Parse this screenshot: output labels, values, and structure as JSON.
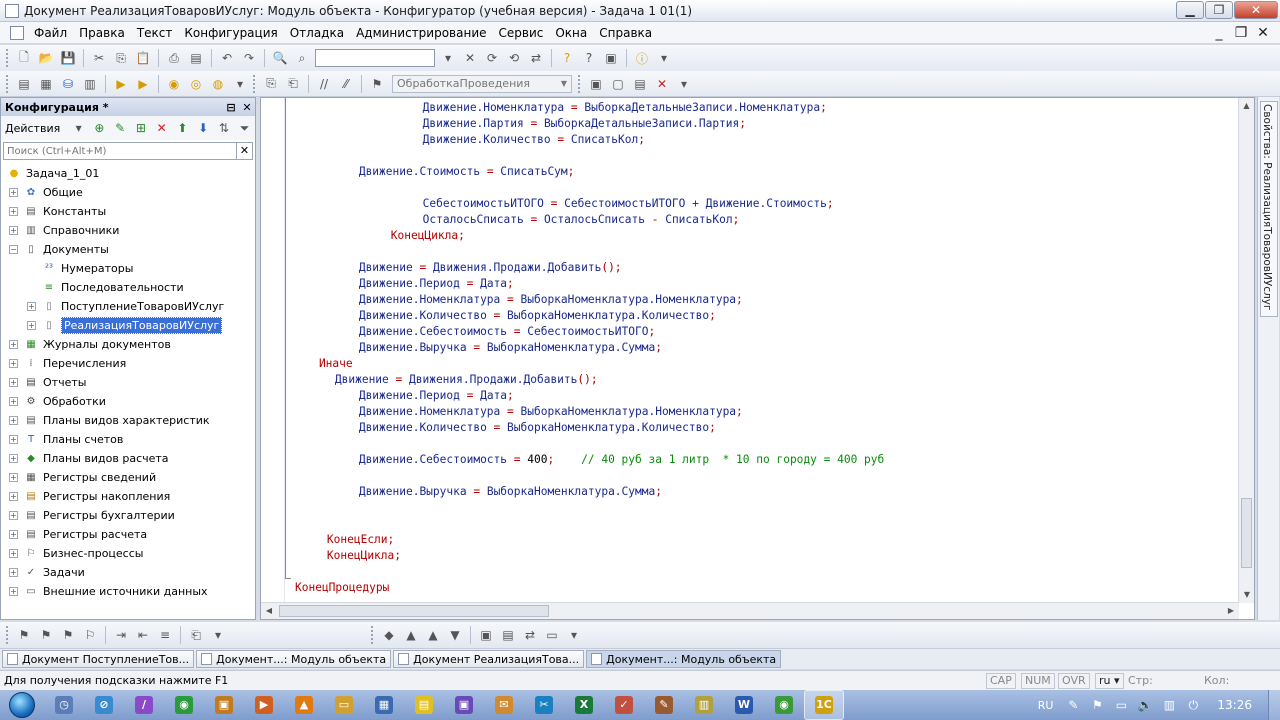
{
  "window": {
    "title": "Документ РеализацияТоваровИУслуг: Модуль объекта - Конфигуратор (учебная версия) - Задача 1 01(1)"
  },
  "menu": [
    "Файл",
    "Правка",
    "Текст",
    "Конфигурация",
    "Отладка",
    "Администрирование",
    "Сервис",
    "Окна",
    "Справка"
  ],
  "toolbar2": {
    "procedure_combo": "ОбработкаПроведения"
  },
  "config_panel": {
    "title": "Конфигурация *",
    "actions_label": "Действия",
    "search_placeholder": "Поиск (Ctrl+Alt+M)",
    "tree": [
      {
        "label": "Задача_1_01",
        "icon": "config-root-icon",
        "level": 0,
        "expander": ""
      },
      {
        "label": "Общие",
        "icon": "common-icon",
        "level": 1,
        "expander": "+"
      },
      {
        "label": "Константы",
        "icon": "constants-icon",
        "level": 1,
        "expander": "+"
      },
      {
        "label": "Справочники",
        "icon": "catalogs-icon",
        "level": 1,
        "expander": "+"
      },
      {
        "label": "Документы",
        "icon": "documents-icon",
        "level": 1,
        "expander": "−"
      },
      {
        "label": "Нумераторы",
        "icon": "numerators-icon",
        "level": 2,
        "expander": ""
      },
      {
        "label": "Последовательности",
        "icon": "sequences-icon",
        "level": 2,
        "expander": ""
      },
      {
        "label": "ПоступлениеТоваровИУслуг",
        "icon": "document-icon",
        "level": 2,
        "expander": "+"
      },
      {
        "label": "РеализацияТоваровИУслуг",
        "icon": "document-icon",
        "level": 2,
        "expander": "+",
        "selected": true
      },
      {
        "label": "Журналы документов",
        "icon": "journals-icon",
        "level": 1,
        "expander": "+"
      },
      {
        "label": "Перечисления",
        "icon": "enums-icon",
        "level": 1,
        "expander": "+"
      },
      {
        "label": "Отчеты",
        "icon": "reports-icon",
        "level": 1,
        "expander": "+"
      },
      {
        "label": "Обработки",
        "icon": "dataprocessors-icon",
        "level": 1,
        "expander": "+"
      },
      {
        "label": "Планы видов характеристик",
        "icon": "chart-of-characteristic-types-icon",
        "level": 1,
        "expander": "+"
      },
      {
        "label": "Планы счетов",
        "icon": "chart-of-accounts-icon",
        "level": 1,
        "expander": "+"
      },
      {
        "label": "Планы видов расчета",
        "icon": "chart-of-calculation-types-icon",
        "level": 1,
        "expander": "+"
      },
      {
        "label": "Регистры сведений",
        "icon": "information-registers-icon",
        "level": 1,
        "expander": "+"
      },
      {
        "label": "Регистры накопления",
        "icon": "accumulation-registers-icon",
        "level": 1,
        "expander": "+"
      },
      {
        "label": "Регистры бухгалтерии",
        "icon": "accounting-registers-icon",
        "level": 1,
        "expander": "+"
      },
      {
        "label": "Регистры расчета",
        "icon": "calculation-registers-icon",
        "level": 1,
        "expander": "+"
      },
      {
        "label": "Бизнес-процессы",
        "icon": "business-processes-icon",
        "level": 1,
        "expander": "+"
      },
      {
        "label": "Задачи",
        "icon": "tasks-icon",
        "level": 1,
        "expander": "+"
      },
      {
        "label": "Внешние источники данных",
        "icon": "external-data-sources-icon",
        "level": 1,
        "expander": "+"
      }
    ]
  },
  "code_lines": [
    {
      "indent": 16,
      "tokens": [
        [
          "id",
          "Движение.Номенклатура"
        ],
        [
          "op",
          " = "
        ],
        [
          "id",
          "ВыборкаДетальныеЗаписи.Номенклатура"
        ],
        [
          "op",
          ";"
        ]
      ]
    },
    {
      "indent": 16,
      "tokens": [
        [
          "id",
          "Движение.Партия"
        ],
        [
          "op",
          " = "
        ],
        [
          "id",
          "ВыборкаДетальныеЗаписи.Партия"
        ],
        [
          "op",
          ";"
        ]
      ]
    },
    {
      "indent": 16,
      "tokens": [
        [
          "id",
          "Движение.Количество"
        ],
        [
          "op",
          " = "
        ],
        [
          "id",
          "СписатьКол"
        ],
        [
          "op",
          ";"
        ]
      ]
    },
    {
      "indent": 0,
      "tokens": []
    },
    {
      "indent": 8,
      "tokens": [
        [
          "id",
          "Движение.Стоимость"
        ],
        [
          "op",
          " = "
        ],
        [
          "id",
          "СписатьСум"
        ],
        [
          "op",
          ";"
        ]
      ]
    },
    {
      "indent": 0,
      "tokens": []
    },
    {
      "indent": 16,
      "tokens": [
        [
          "id",
          "СебестоимостьИТОГО"
        ],
        [
          "op",
          " = "
        ],
        [
          "id",
          "СебестоимостьИТОГО"
        ],
        [
          "op",
          " + "
        ],
        [
          "id",
          "Движение.Стоимость"
        ],
        [
          "op",
          ";"
        ]
      ]
    },
    {
      "indent": 16,
      "tokens": [
        [
          "id",
          "ОсталосьСписать"
        ],
        [
          "op",
          " = "
        ],
        [
          "id",
          "ОсталосьСписать"
        ],
        [
          "op",
          " - "
        ],
        [
          "id",
          "СписатьКол"
        ],
        [
          "op",
          ";"
        ]
      ]
    },
    {
      "indent": 12,
      "tokens": [
        [
          "kw",
          "КонецЦикла"
        ],
        [
          "op",
          ";"
        ]
      ]
    },
    {
      "indent": 0,
      "tokens": []
    },
    {
      "indent": 8,
      "tokens": [
        [
          "id",
          "Движение"
        ],
        [
          "op",
          " = "
        ],
        [
          "id",
          "Движения.Продажи.Добавить"
        ],
        [
          "op",
          "();"
        ]
      ]
    },
    {
      "indent": 8,
      "tokens": [
        [
          "id",
          "Движение.Период"
        ],
        [
          "op",
          " = "
        ],
        [
          "id",
          "Дата"
        ],
        [
          "op",
          ";"
        ]
      ]
    },
    {
      "indent": 8,
      "tokens": [
        [
          "id",
          "Движение.Номенклатура"
        ],
        [
          "op",
          " = "
        ],
        [
          "id",
          "ВыборкаНоменклатура.Номенклатура"
        ],
        [
          "op",
          ";"
        ]
      ]
    },
    {
      "indent": 8,
      "tokens": [
        [
          "id",
          "Движение.Количество"
        ],
        [
          "op",
          " = "
        ],
        [
          "id",
          "ВыборкаНоменклатура.Количество"
        ],
        [
          "op",
          ";"
        ]
      ]
    },
    {
      "indent": 8,
      "tokens": [
        [
          "id",
          "Движение.Себестоимость"
        ],
        [
          "op",
          " = "
        ],
        [
          "id",
          "СебестоимостьИТОГО"
        ],
        [
          "op",
          ";"
        ]
      ]
    },
    {
      "indent": 8,
      "tokens": [
        [
          "id",
          "Движение.Выручка"
        ],
        [
          "op",
          " = "
        ],
        [
          "id",
          "ВыборкаНоменклатура.Сумма"
        ],
        [
          "op",
          ";"
        ]
      ]
    },
    {
      "indent": 3,
      "tokens": [
        [
          "kw",
          "Иначе"
        ]
      ]
    },
    {
      "indent": 5,
      "tokens": [
        [
          "id",
          "Движение"
        ],
        [
          "op",
          " = "
        ],
        [
          "id",
          "Движения.Продажи.Добавить"
        ],
        [
          "op",
          "();"
        ]
      ]
    },
    {
      "indent": 8,
      "tokens": [
        [
          "id",
          "Движение.Период"
        ],
        [
          "op",
          " = "
        ],
        [
          "id",
          "Дата"
        ],
        [
          "op",
          ";"
        ]
      ]
    },
    {
      "indent": 8,
      "tokens": [
        [
          "id",
          "Движение.Номенклатура"
        ],
        [
          "op",
          " = "
        ],
        [
          "id",
          "ВыборкаНоменклатура.Номенклатура"
        ],
        [
          "op",
          ";"
        ]
      ]
    },
    {
      "indent": 8,
      "tokens": [
        [
          "id",
          "Движение.Количество"
        ],
        [
          "op",
          " = "
        ],
        [
          "id",
          "ВыборкаНоменклатура.Количество"
        ],
        [
          "op",
          ";"
        ]
      ]
    },
    {
      "indent": 0,
      "tokens": []
    },
    {
      "indent": 8,
      "tokens": [
        [
          "id",
          "Движение.Себестоимость"
        ],
        [
          "op",
          " = "
        ],
        [
          "num",
          "400"
        ],
        [
          "op",
          ";"
        ],
        [
          "cm",
          "    // 40 руб за 1 литр  * 10 по городу = 400 руб"
        ]
      ]
    },
    {
      "indent": 0,
      "tokens": []
    },
    {
      "indent": 8,
      "tokens": [
        [
          "id",
          "Движение.Выручка"
        ],
        [
          "op",
          " = "
        ],
        [
          "id",
          "ВыборкаНоменклатура.Сумма"
        ],
        [
          "op",
          ";"
        ]
      ]
    },
    {
      "indent": 0,
      "tokens": []
    },
    {
      "indent": 0,
      "tokens": []
    },
    {
      "indent": 4,
      "tokens": [
        [
          "kw",
          "КонецЕсли"
        ],
        [
          "op",
          ";"
        ]
      ]
    },
    {
      "indent": 4,
      "tokens": [
        [
          "kw",
          "КонецЦикла"
        ],
        [
          "op",
          ";"
        ]
      ]
    },
    {
      "indent": 0,
      "tokens": []
    },
    {
      "indent": 0,
      "tokens": [
        [
          "kw",
          "КонецПроцедуры"
        ]
      ]
    }
  ],
  "right_panel": {
    "tab_label": "Свойства: РеализацияТоваровИУслуг"
  },
  "window_tabs": [
    {
      "label": "Документ ПоступлениеТов...",
      "active": false
    },
    {
      "label": "Документ...: Модуль объекта",
      "active": false
    },
    {
      "label": "Документ РеализацияТова...",
      "active": false
    },
    {
      "label": "Документ...: Модуль объекта",
      "active": true
    }
  ],
  "status": {
    "hint": "Для получения подсказки нажмите F1",
    "cap": "CAP",
    "num": "NUM",
    "ovr": "OVR",
    "lang": "ru",
    "line_label": "Стр:",
    "col_label": "Кол:"
  },
  "taskbar": {
    "apps": [
      "clock-icon",
      "safari-icon",
      "feather-icon",
      "chrome-icon",
      "files-icon",
      "media-player-icon",
      "vlc-icon",
      "folder-icon",
      "paint-icon",
      "sticky-notes-icon",
      "save-icon",
      "mail-icon",
      "scissors-icon",
      "excel-icon",
      "checkmark-icon",
      "editor-icon",
      "picture-icon",
      "word-icon",
      "chrome2-icon",
      "1c-icon"
    ],
    "lang": "RU",
    "time": "13:26"
  }
}
